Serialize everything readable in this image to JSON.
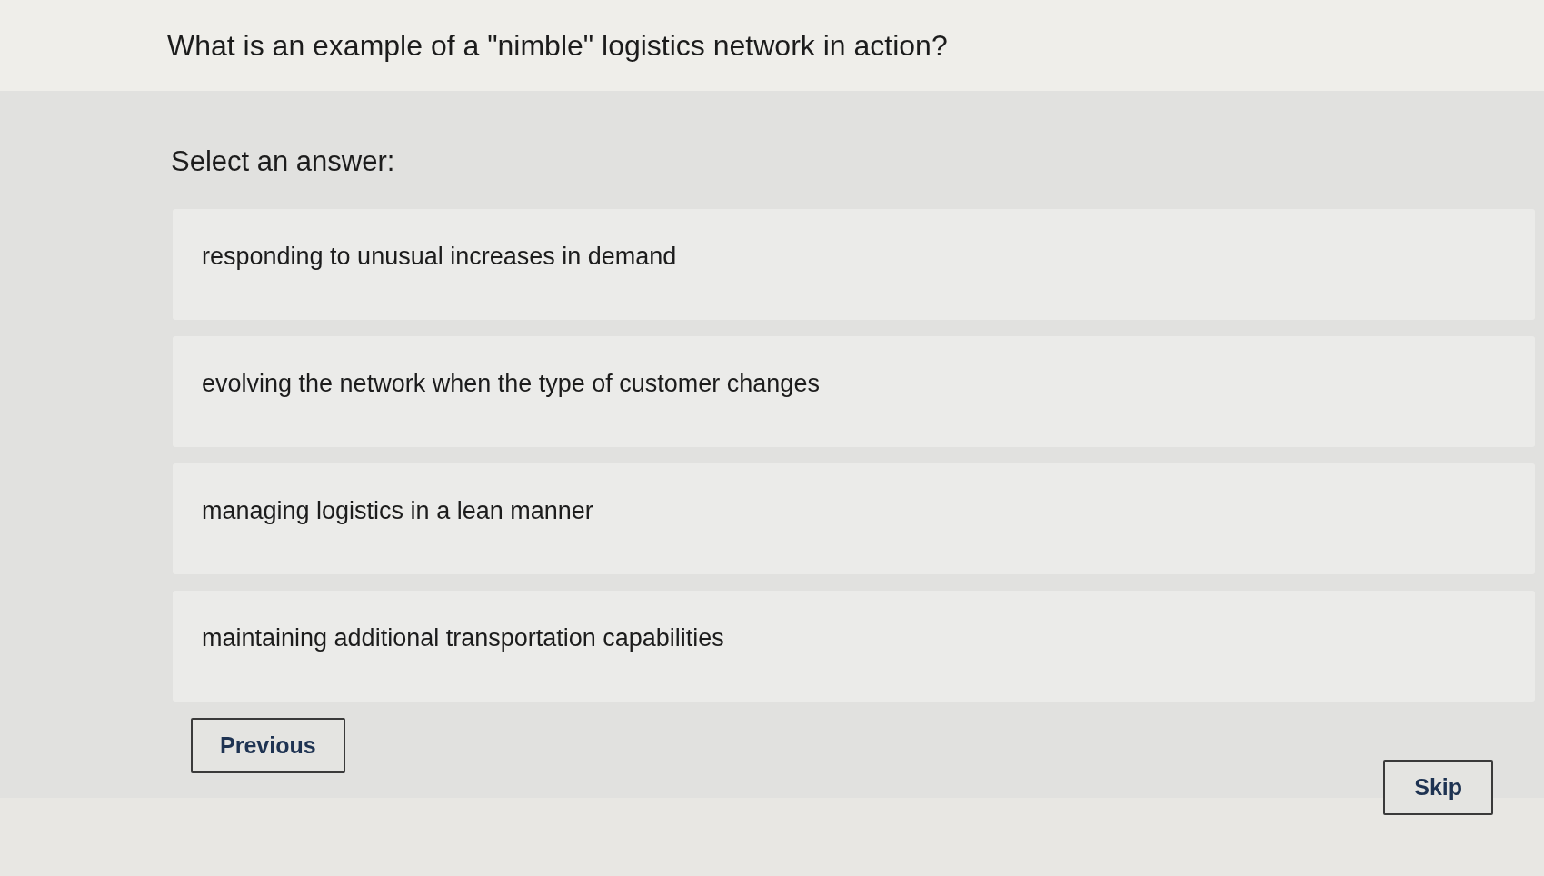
{
  "question": {
    "text": "What is an example of a \"nimble\" logistics network in action?"
  },
  "prompt": "Select an answer:",
  "answers": [
    {
      "label": "responding to unusual increases in demand",
      "selected": false
    },
    {
      "label": "evolving the network when the type of customer changes",
      "selected": false
    },
    {
      "label": "managing logistics in a lean manner",
      "selected": false
    },
    {
      "label": "maintaining additional transportation capabilities",
      "selected": false
    }
  ],
  "buttons": {
    "previous": "Previous",
    "skip": "Skip"
  }
}
